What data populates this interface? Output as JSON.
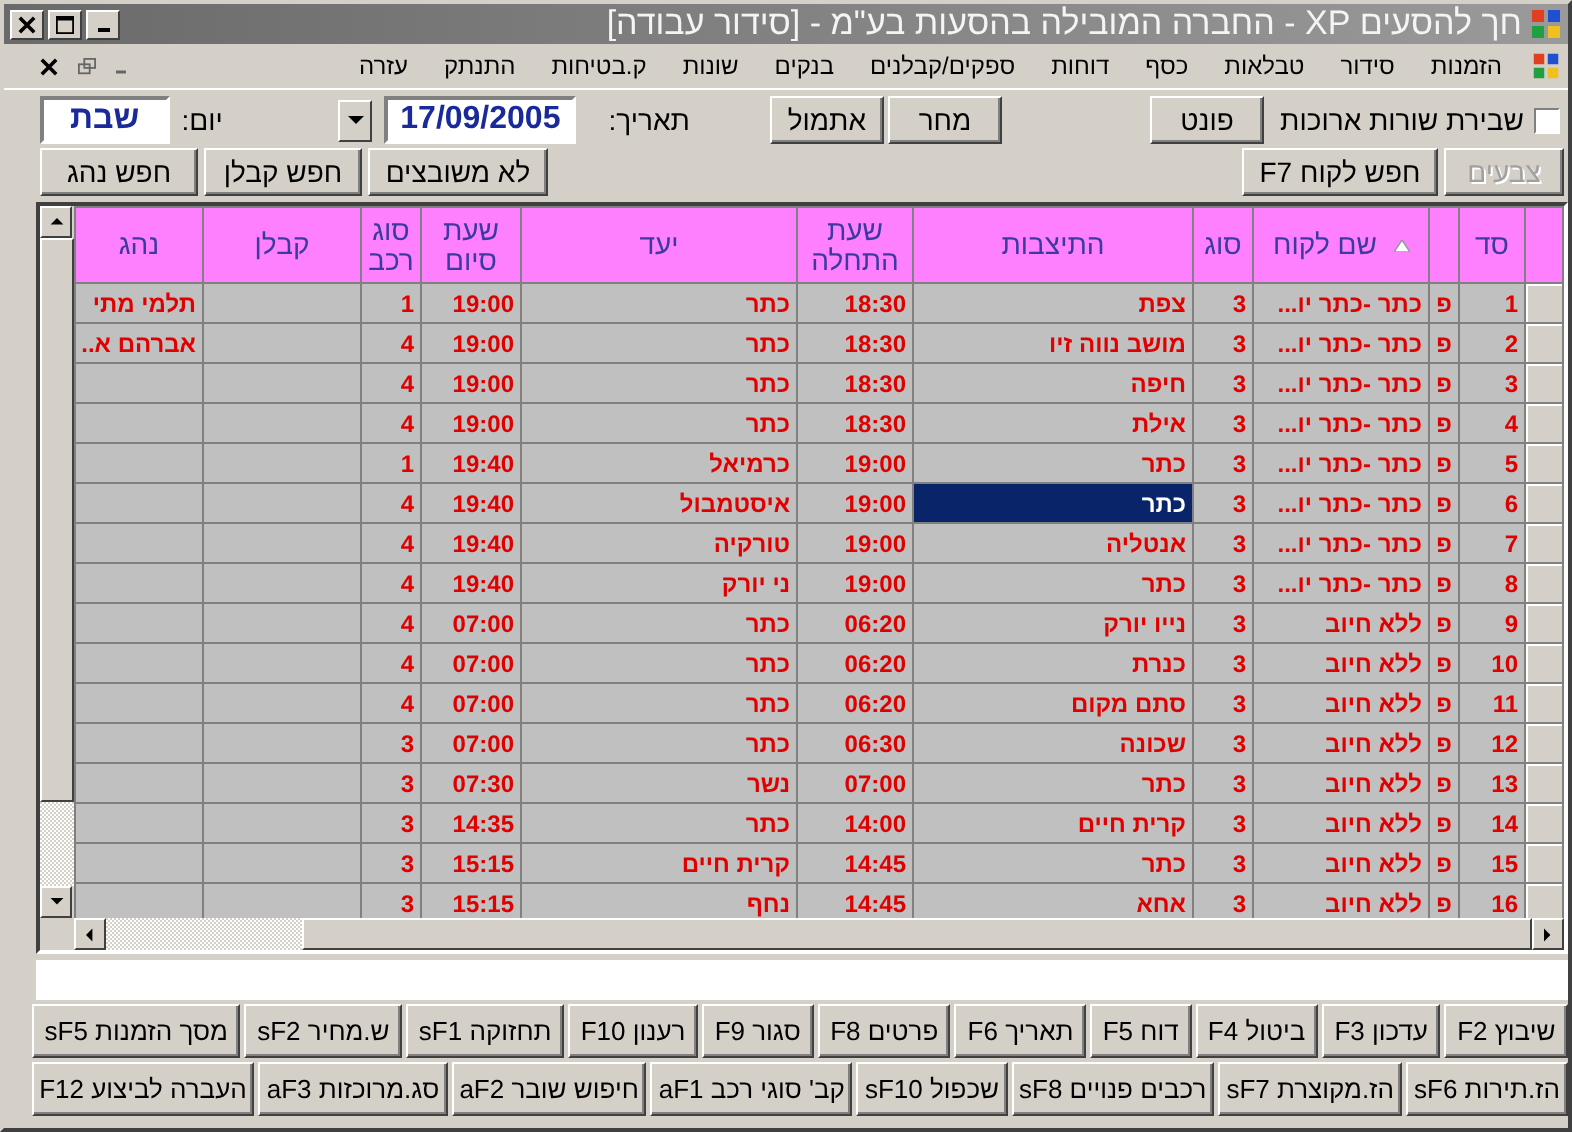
{
  "window": {
    "title": "חך להסעים XP - החברה המובילה בהסעות בע\"מ - [סידור עבודה]"
  },
  "menu": [
    "הזמנות",
    "סידור",
    "טבלאות",
    "כסף",
    "דוחות",
    "ספקים/קבלנים",
    "בנקים",
    "שונות",
    "ק.בטיחות",
    "התנתק",
    "עזרה"
  ],
  "toolbar": {
    "wrap_lines": {
      "label": "שבירת שורות ארוכות",
      "checked": false
    },
    "font_button": "פונט",
    "next_button": "מחר",
    "prev_button": "אתמול",
    "date_label": "תאריך:",
    "date": "17/09/2005",
    "day_label": "יום:",
    "day": "שבת"
  },
  "search_bar": {
    "colors_button": {
      "label": "צבעים",
      "disabled": true
    },
    "find_customer": "חפש לקוח F7",
    "unassigned": "לא משובצים",
    "find_contractor": "חפש קבלן",
    "find_driver": "חפש נהג"
  },
  "table": {
    "columns": [
      {
        "label": "סד",
        "sorted": false
      },
      {
        "sorted": false
      },
      {
        "label": "שם לקוח",
        "sorted": true
      },
      {
        "label": "סוג",
        "sorted": false
      },
      {
        "label": "התיצבות",
        "sorted": false
      },
      {
        "label": "שעת התחלה",
        "sorted": false
      },
      {
        "label": "יעד",
        "sorted": false
      },
      {
        "label": "שעת סיום",
        "sorted": false
      },
      {
        "label": "סוג רכב",
        "sorted": false
      },
      {
        "label": "קבלן",
        "sorted": false
      },
      {
        "label": "נהג",
        "sorted": false
      }
    ],
    "rows": [
      {
        "num": "1",
        "flag": "פ",
        "customer": "כתר -כתר יו...",
        "type": "3",
        "pickup": "צפת",
        "start": "18:30",
        "destination": "כתר",
        "end": "19:00",
        "vehicle": "1",
        "driver": "תלמי מתי",
        "selected": false
      },
      {
        "num": "2",
        "flag": "פ",
        "customer": "כתר -כתר יו...",
        "type": "3",
        "pickup": "מושב נווה זיו",
        "start": "18:30",
        "destination": "כתר",
        "end": "19:00",
        "vehicle": "4",
        "driver": "אברהם א..",
        "selected": false
      },
      {
        "num": "3",
        "flag": "פ",
        "customer": "כתר -כתר יו...",
        "type": "3",
        "pickup": "חיפה",
        "start": "18:30",
        "destination": "כתר",
        "end": "19:00",
        "vehicle": "4",
        "selected": false
      },
      {
        "num": "4",
        "flag": "פ",
        "customer": "כתר -כתר יו...",
        "type": "3",
        "pickup": "אילת",
        "start": "18:30",
        "destination": "כתר",
        "end": "19:00",
        "vehicle": "4",
        "selected": false
      },
      {
        "num": "5",
        "flag": "פ",
        "customer": "כתר -כתר יו...",
        "type": "3",
        "pickup": "כתר",
        "start": "19:00",
        "destination": "כרמיאל",
        "end": "19:40",
        "vehicle": "1",
        "selected": false
      },
      {
        "num": "6",
        "flag": "פ",
        "customer": "כתר -כתר יו...",
        "type": "3",
        "pickup": "כתר",
        "start": "19:00",
        "destination": "איסטמבול",
        "end": "19:40",
        "vehicle": "4",
        "selected": true
      },
      {
        "num": "7",
        "flag": "פ",
        "customer": "כתר -כתר יו...",
        "type": "3",
        "pickup": "אנטליה",
        "start": "19:00",
        "destination": "טורקיה",
        "end": "19:40",
        "vehicle": "4",
        "selected": false
      },
      {
        "num": "8",
        "flag": "פ",
        "customer": "כתר -כתר יו...",
        "type": "3",
        "pickup": "כתר",
        "start": "19:00",
        "destination": "ני יורק",
        "end": "19:40",
        "vehicle": "4",
        "selected": false
      },
      {
        "num": "9",
        "flag": "פ",
        "customer": "ללא חיוב",
        "type": "3",
        "pickup": "נייו יורק",
        "start": "06:20",
        "destination": "כתר",
        "end": "07:00",
        "vehicle": "4",
        "selected": false
      },
      {
        "num": "10",
        "flag": "פ",
        "customer": "ללא חיוב",
        "type": "3",
        "pickup": "כנרת",
        "start": "06:20",
        "destination": "כתר",
        "end": "07:00",
        "vehicle": "4",
        "selected": false
      },
      {
        "num": "11",
        "flag": "פ",
        "customer": "ללא חיוב",
        "type": "3",
        "pickup": "סתם מקום",
        "start": "06:20",
        "destination": "כתר",
        "end": "07:00",
        "vehicle": "4",
        "selected": false
      },
      {
        "num": "12",
        "flag": "פ",
        "customer": "ללא חיוב",
        "type": "3",
        "pickup": "שכונה",
        "start": "06:30",
        "destination": "כתר",
        "end": "07:00",
        "vehicle": "3",
        "selected": false
      },
      {
        "num": "13",
        "flag": "פ",
        "customer": "ללא חיוב",
        "type": "3",
        "pickup": "כתר",
        "start": "07:00",
        "destination": "נשר",
        "end": "07:30",
        "vehicle": "3",
        "selected": false
      },
      {
        "num": "14",
        "flag": "פ",
        "customer": "ללא חיוב",
        "type": "3",
        "pickup": "קרית חיים",
        "start": "14:00",
        "destination": "כתר",
        "end": "14:35",
        "vehicle": "3",
        "selected": false
      },
      {
        "num": "15",
        "flag": "פ",
        "customer": "ללא חיוב",
        "type": "3",
        "pickup": "כתר",
        "start": "14:45",
        "destination": "קרית חיים",
        "end": "15:15",
        "vehicle": "3",
        "selected": false
      },
      {
        "num": "16",
        "flag": "פ",
        "customer": "ללא חיוב",
        "type": "3",
        "pickup": "אחא",
        "start": "14:45",
        "destination": "נחף",
        "end": "15:15",
        "vehicle": "3",
        "selected": false
      }
    ]
  },
  "function_keys": [
    [
      "שיבוץ F2",
      "עדכון F3",
      "ביטול F4",
      "דוח F5",
      "תאריך F6",
      "פרטים F8",
      "סגור F9",
      "רענון F10",
      "תחזוקה sF1",
      "ש.מחיר sF2",
      "מסך הזמנות sF5"
    ],
    [
      "הז.תירות sF6",
      "הז.מקוצרת sF7",
      "רכבים פנויים sF8",
      "שכפול sF10",
      "קב' סוגי רכב aF1",
      "חיפוש שובר aF2",
      "סג.מרוכזות aF3",
      "העברה לביצוע F12"
    ]
  ]
}
